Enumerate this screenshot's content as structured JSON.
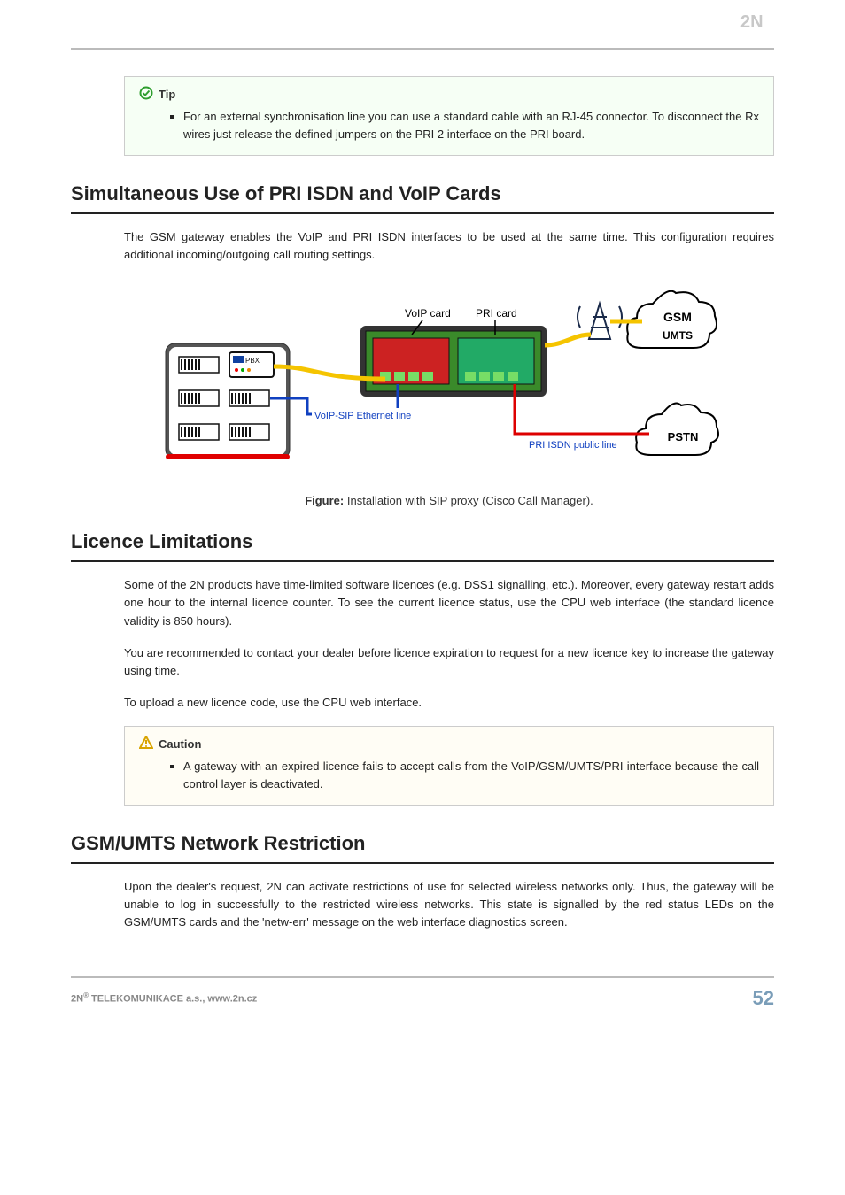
{
  "header": {
    "brand": "2N"
  },
  "tip": {
    "label": "Tip",
    "bullet": "For an external synchronisation line you can use a standard cable with an RJ-45 connector. To disconnect the Rx wires just release the defined jumpers on the PRI 2 interface on the PRI board."
  },
  "section1": {
    "title": "Simultaneous Use of PRI ISDN and VoIP Cards",
    "p1": "The GSM gateway enables the VoIP and PRI ISDN interfaces to be used at the same time. This configuration requires additional incoming/outgoing call routing settings."
  },
  "figure": {
    "labels": {
      "voip_card": "VoIP card",
      "pri_card": "PRI card",
      "gsm": "GSM",
      "umts": "UMTS",
      "pstn": "PSTN",
      "voip_line": "VoIP-SIP Ethernet line",
      "pri_line": "PRI ISDN public line",
      "pbx": "PBX"
    },
    "caption_prefix": "Figure:",
    "caption_text": " Installation with SIP proxy (Cisco Call Manager)."
  },
  "section2": {
    "title": "Licence Limitations",
    "p1": "Some of the 2N products have time-limited software licences (e.g. DSS1 signalling, etc.). Moreover, every gateway restart adds one hour to the internal licence counter. To see the current licence status, use the CPU web interface (the standard licence validity is 850 hours).",
    "p2": "You are recommended to contact your dealer before licence expiration to request for a new licence key to increase the gateway using time.",
    "p3": "To upload a new licence code, use the CPU web interface."
  },
  "caution": {
    "label": "Caution",
    "bullet": "A gateway with an expired licence fails to accept calls from the VoIP/GSM/UMTS/PRI interface because the call control layer is deactivated."
  },
  "section3": {
    "title": "GSM/UMTS Network Restriction",
    "p1": "Upon the dealer's request, 2N can activate restrictions of use for selected wireless networks only. Thus, the gateway will be unable to log in successfully to the restricted wireless networks. This state is signalled by the red status LEDs on the GSM/UMTS cards and the 'netw-err' message on the web interface diagnostics screen."
  },
  "footer": {
    "left_prefix": "2N",
    "left_sup": "®",
    "left_rest": " TELEKOMUNIKACE a.s., www.2n.cz",
    "page": "52"
  }
}
